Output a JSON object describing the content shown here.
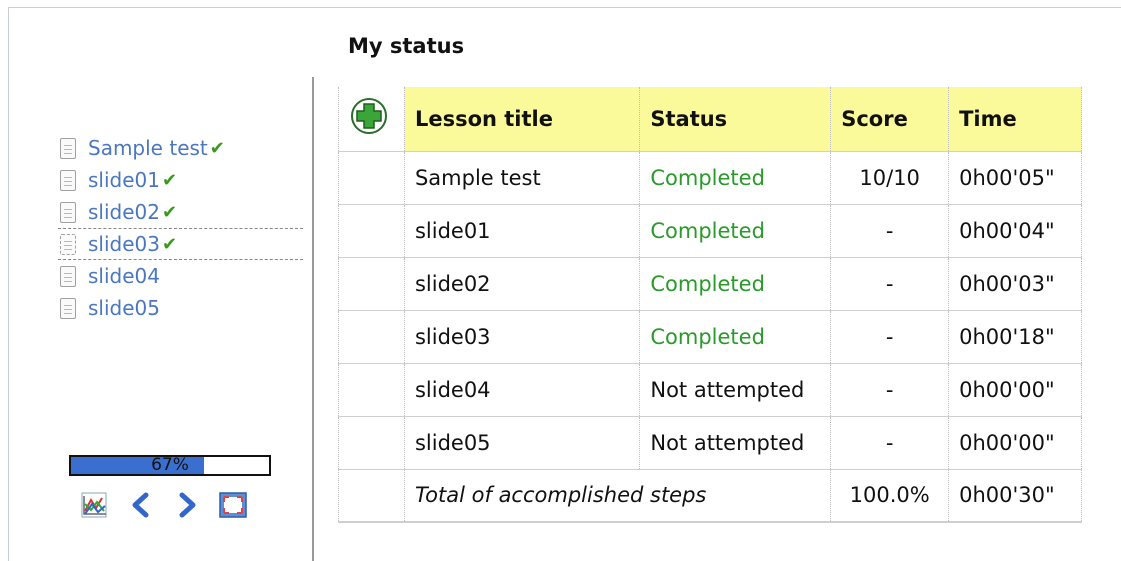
{
  "page": {
    "title": "My status"
  },
  "toc": {
    "items": [
      {
        "label": "Sample test",
        "completed": true,
        "current": false
      },
      {
        "label": "slide01",
        "completed": true,
        "current": false
      },
      {
        "label": "slide02",
        "completed": true,
        "current": false
      },
      {
        "label": "slide03",
        "completed": true,
        "current": true
      },
      {
        "label": "slide04",
        "completed": false,
        "current": false
      },
      {
        "label": "slide05",
        "completed": false,
        "current": false
      }
    ],
    "check_glyph": "✔"
  },
  "progress": {
    "percent": 0.67,
    "label": "67%"
  },
  "nav": {
    "icons": [
      "chart-icon",
      "previous-icon",
      "next-icon",
      "fullscreen-icon"
    ]
  },
  "table": {
    "expand_icon": "plus-icon",
    "headers": {
      "title": "Lesson title",
      "status": "Status",
      "score": "Score",
      "time": "Time"
    },
    "rows": [
      {
        "title": "Sample test",
        "status": "Completed",
        "score": "10/10",
        "time": "0h00'05\""
      },
      {
        "title": "slide01",
        "status": "Completed",
        "score": "-",
        "time": "0h00'04\""
      },
      {
        "title": "slide02",
        "status": "Completed",
        "score": "-",
        "time": "0h00'03\""
      },
      {
        "title": "slide03",
        "status": "Completed",
        "score": "-",
        "time": "0h00'18\""
      },
      {
        "title": "slide04",
        "status": "Not attempted",
        "score": "-",
        "time": "0h00'00\""
      },
      {
        "title": "slide05",
        "status": "Not attempted",
        "score": "-",
        "time": "0h00'00\""
      }
    ],
    "total": {
      "label": "Total of accomplished steps",
      "score": "100.0%",
      "time": "0h00'30\""
    }
  },
  "colors": {
    "header_bg": "#fafa9a",
    "completed": "#2a9a2a",
    "link": "#4a77c0",
    "progress": "#3a6fd0"
  }
}
